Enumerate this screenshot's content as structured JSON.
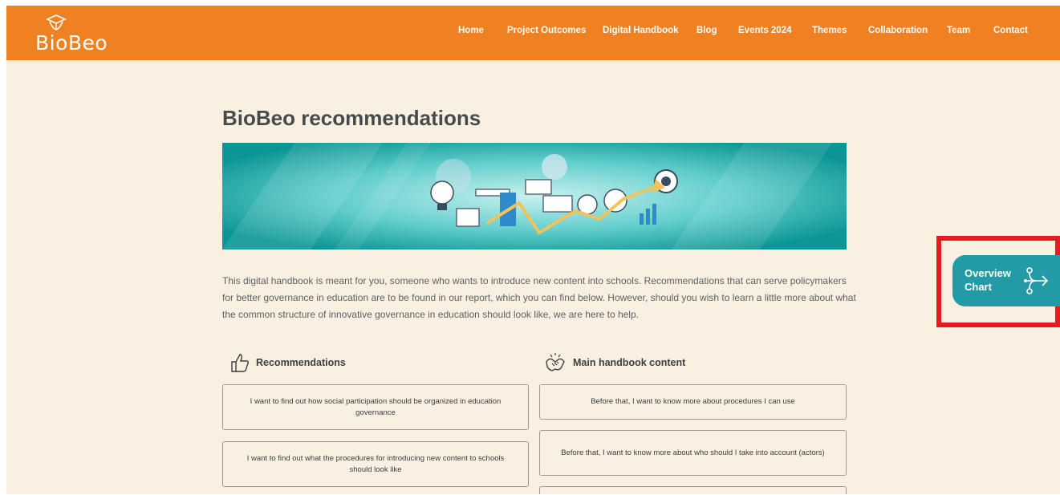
{
  "brand": {
    "name": "BioBeo"
  },
  "nav": {
    "items": [
      {
        "label": "Home"
      },
      {
        "label": "Project Outcomes"
      },
      {
        "label": "Digital Handbook"
      },
      {
        "label": "Blog"
      },
      {
        "label": "Events 2024"
      },
      {
        "label": "Themes"
      },
      {
        "label": "Collaboration"
      },
      {
        "label": "Team"
      },
      {
        "label": "Contact"
      }
    ]
  },
  "page": {
    "title": "BioBeo recommendations",
    "intro": "This digital handbook is meant for you, someone who wants to introduce new content into schools. Recommendations that can serve policymakers for better governance in education are to be found in our report, which you can find below. However, should you wish to learn a little more about what the common structure of innovative governance in education should look like, we are here to help."
  },
  "recommendations": {
    "heading": "Recommendations",
    "icon": "thumbs-up-icon",
    "items": [
      {
        "label": "I want to find out how social participation should be organized in education governance"
      },
      {
        "label": "I want to find out what the procedures for introducing new content to schools should look like"
      }
    ]
  },
  "handbook": {
    "heading": "Main handbook content",
    "icon": "handshake-icon",
    "items": [
      {
        "label": "Before that, I want to know more about procedures I can use"
      },
      {
        "label": "Before that, I want to know more about who should I take into account (actors)"
      },
      {
        "label": ""
      }
    ]
  },
  "overview": {
    "label": "Overview Chart",
    "icon": "flow-split-icon"
  },
  "colors": {
    "nav": "#ef8122",
    "page_bg": "#f9f0e2",
    "accent_teal": "#239ba6",
    "highlight": "#e8191f"
  }
}
